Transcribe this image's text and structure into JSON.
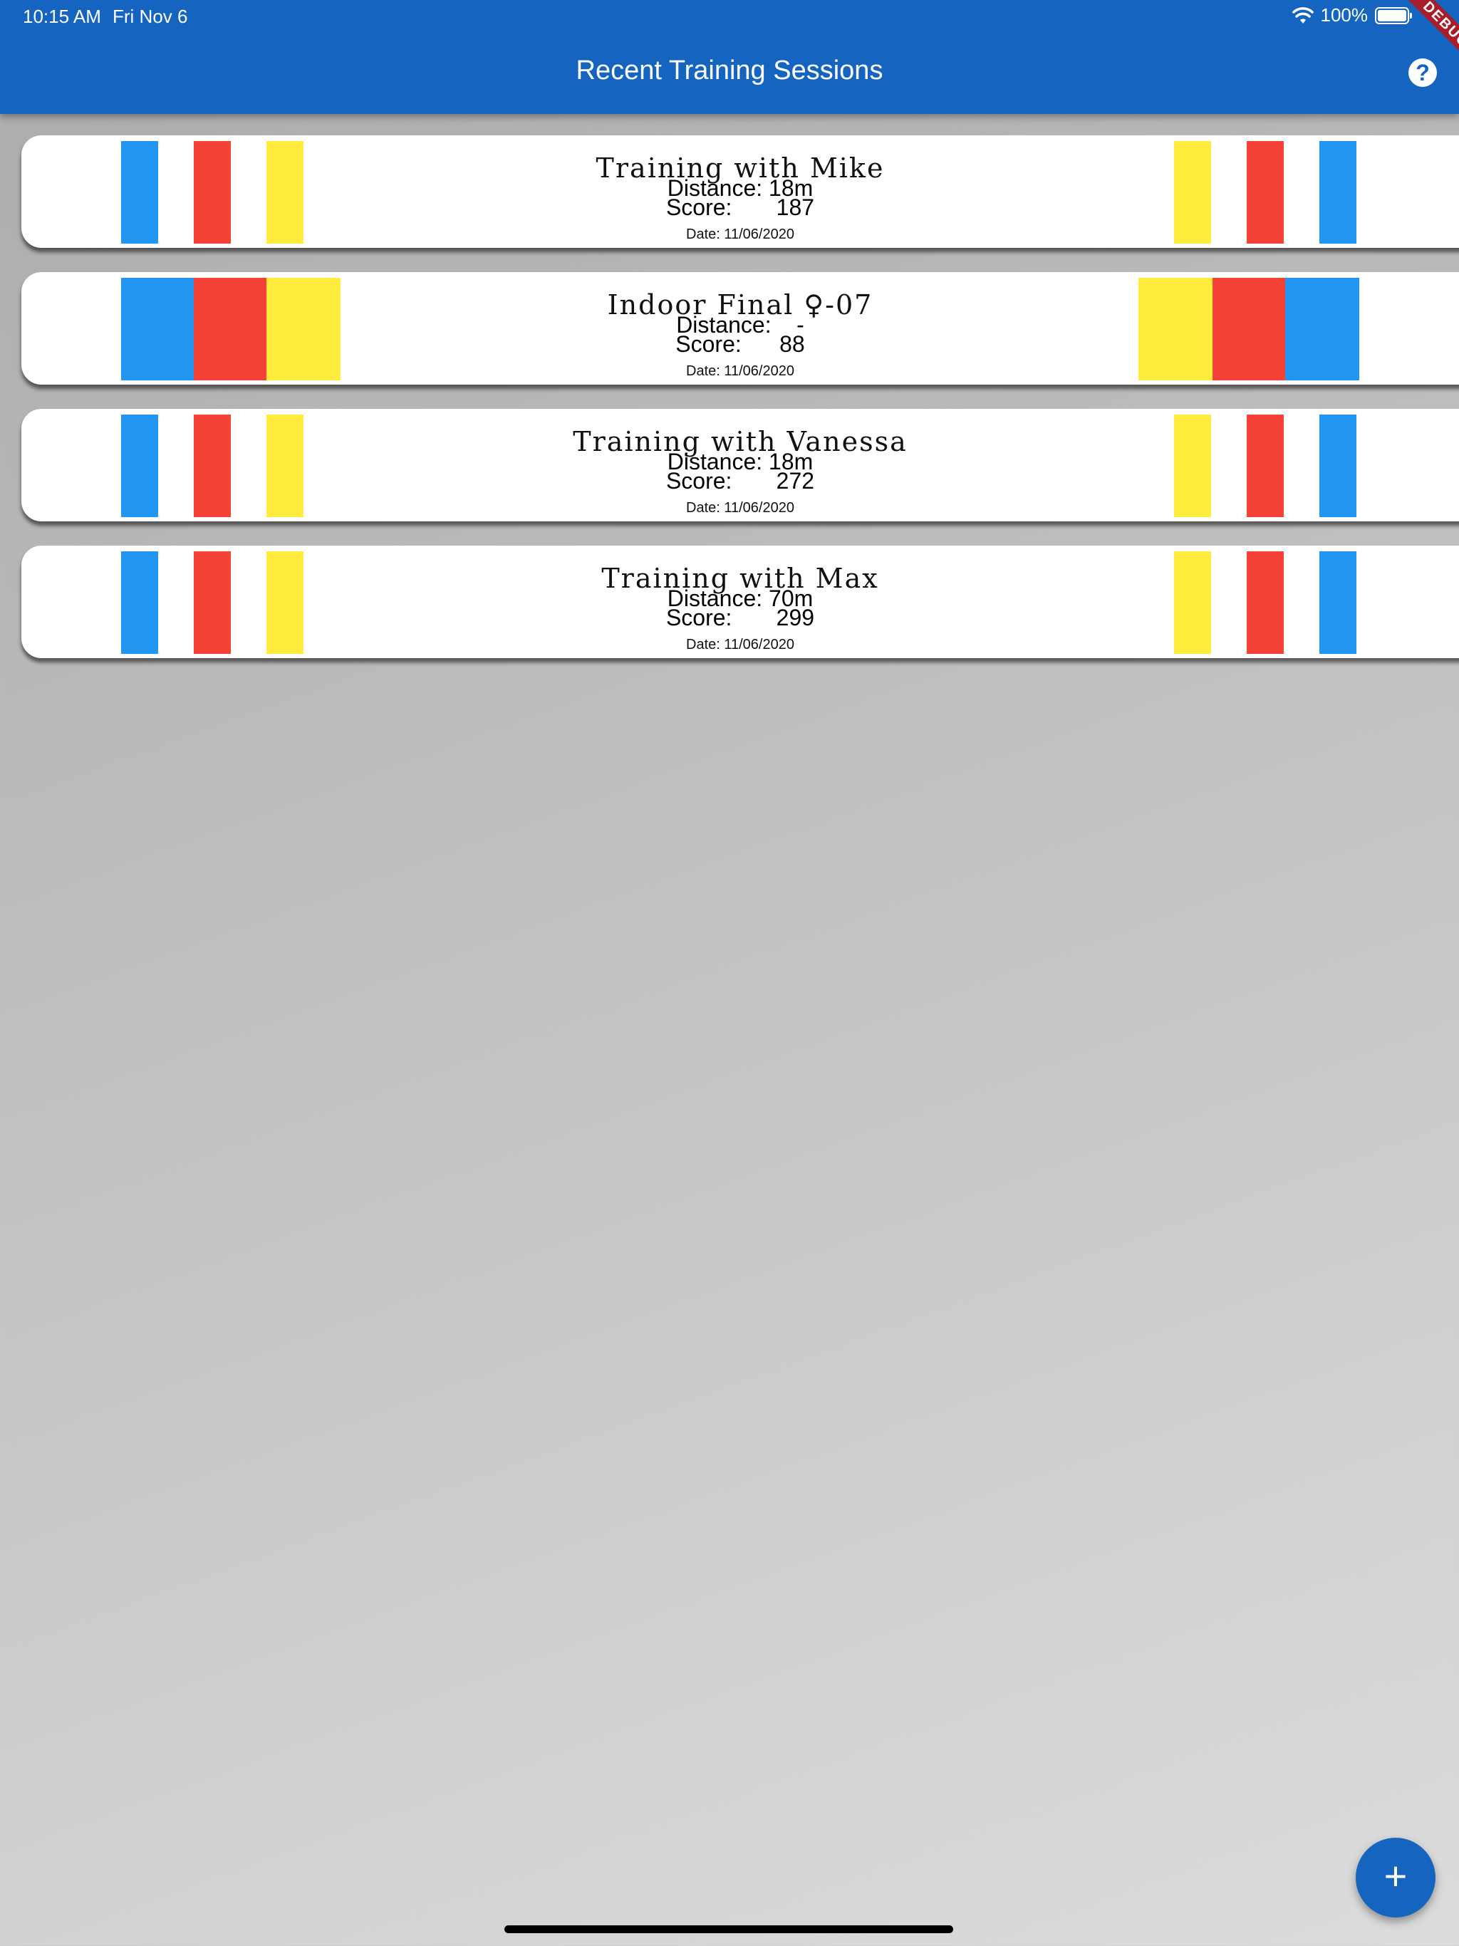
{
  "status_bar": {
    "time": "10:15 AM",
    "date": "Fri Nov 6",
    "battery": "100%",
    "wifi_icon": "wifi-icon",
    "battery_icon": "battery-icon"
  },
  "app_bar": {
    "title": "Recent Training Sessions",
    "help_icon": "help-circle-icon",
    "help_label": "?",
    "color": "#1565c0"
  },
  "debug_banner": "DEBUG",
  "stripe_colors": {
    "blue": "#2196f3",
    "red": "#f44336",
    "yellow": "#ffeb3b"
  },
  "sessions": [
    {
      "title": "Training with Mike",
      "distance": "Distance: 18m",
      "score": "Score:       187",
      "date": "Date: 11/06/2020"
    },
    {
      "title": "Indoor Final ♀-07",
      "distance": "Distance:    -",
      "score": "Score:      88",
      "date": "Date: 11/06/2020"
    },
    {
      "title": "Training with Vanessa",
      "distance": "Distance: 18m",
      "score": "Score:       272",
      "date": "Date: 11/06/2020"
    },
    {
      "title": "Training with Max",
      "distance": "Distance: 70m",
      "score": "Score:       299",
      "date": "Date: 11/06/2020"
    }
  ],
  "fab": {
    "label": "+",
    "icon": "plus-icon"
  }
}
